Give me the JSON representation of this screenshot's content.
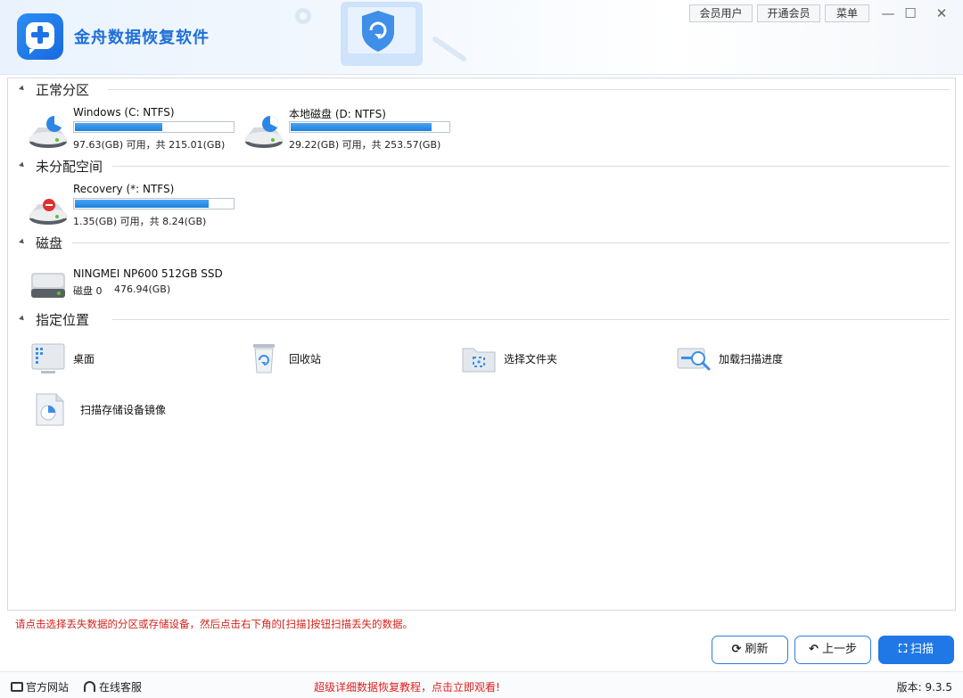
{
  "app": {
    "title": "金舟数据恢复软件",
    "brand_color": "#1e6fd8"
  },
  "top_buttons": {
    "member": "会员用户",
    "open_member": "开通会员",
    "menu": "菜单"
  },
  "window_controls": {
    "minimize": "—",
    "maximize": "☐",
    "close": "✕"
  },
  "sections": {
    "normal": "正常分区",
    "unallocated": "未分配空间",
    "disk": "磁盘",
    "location": "指定位置"
  },
  "drives": [
    {
      "name": "Windows (C: NTFS)",
      "capacity": "97.63(GB) 可用，共 215.01(GB)",
      "used_fraction": 0.546
    },
    {
      "name": "本地磁盘 (D: NTFS)",
      "capacity": "29.22(GB) 可用，共 253.57(GB)",
      "used_fraction": 0.885
    },
    {
      "name": "Recovery (*: NTFS)",
      "capacity": "1.35(GB) 可用，共 8.24(GB)",
      "used_fraction": 0.836
    }
  ],
  "disk": {
    "name": "NINGMEI NP600 512GB SSD",
    "index": "磁盘 0",
    "size": "476.94(GB)"
  },
  "locations": {
    "desktop": "桌面",
    "recycle_bin": "回收站",
    "choose_folder": "选择文件夹",
    "load_progress": "加载扫描进度",
    "scan_image": "扫描存储设备镜像"
  },
  "hint": "请点击选择丢失数据的分区或存储设备，然后点击右下角的[扫描]按钮扫描丢失的数据。",
  "actions": {
    "refresh": "刷新",
    "back": "上一步",
    "scan": "扫描"
  },
  "status_bar": {
    "website": "官方网站",
    "support": "在线客服",
    "promo": "超级详细数据恢复教程，点击立即观看!",
    "version": "版本: 9.3.5"
  }
}
